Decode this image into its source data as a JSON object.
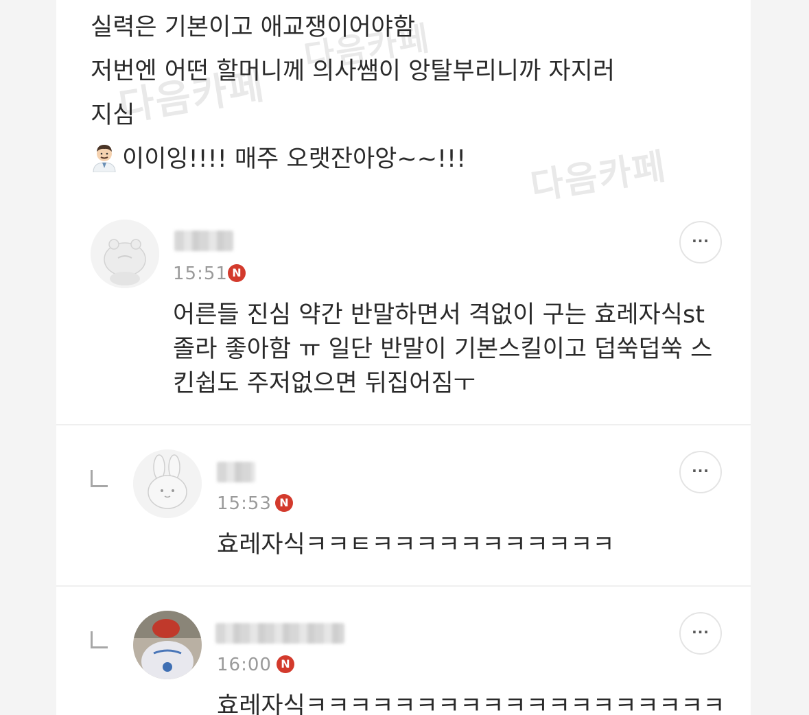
{
  "post": {
    "lines": [
      "실력은 기본이고 애교쟁이어야함",
      "저번엔 어떤 할머니께 의사쌤이 앙탈부리니까 자지러",
      "지심",
      "이이잉!!!! 매주 오랫잔아앙~~!!!"
    ],
    "emoji": "doctor-emoji"
  },
  "watermark": "다음카페",
  "comments": [
    {
      "time": "15:51",
      "badge": "N",
      "more": "···",
      "lines": [
        "어른들 진심 약간 반말하면서 격없이 구는 효레자식st",
        "졸라 좋아함 ㅠ 일단 반말이 기본스킬이고 덥쑥덥쑥 스",
        "킨쉽도 주저없으면 뒤집어짐ㅜ"
      ]
    },
    {
      "time": "15:53",
      "badge": "N",
      "more": "···",
      "lines": [
        "효레자식ㅋㅋㅌㅋㅋㅋㅋㅋㅋㅋㅋㅋㅋㅋ"
      ]
    },
    {
      "time": "16:00",
      "badge": "N",
      "more": "···",
      "lines": [
        "효레자식ㅋㅋㅋㅋㅋㅋㅋㅋㅋㅋㅋㅋㅋㅋㅋㅋㅋㅋㅋ"
      ]
    }
  ],
  "colors": {
    "badge": "#d33a2c",
    "text": "#2a2a2a",
    "time": "#9a9a9a"
  }
}
